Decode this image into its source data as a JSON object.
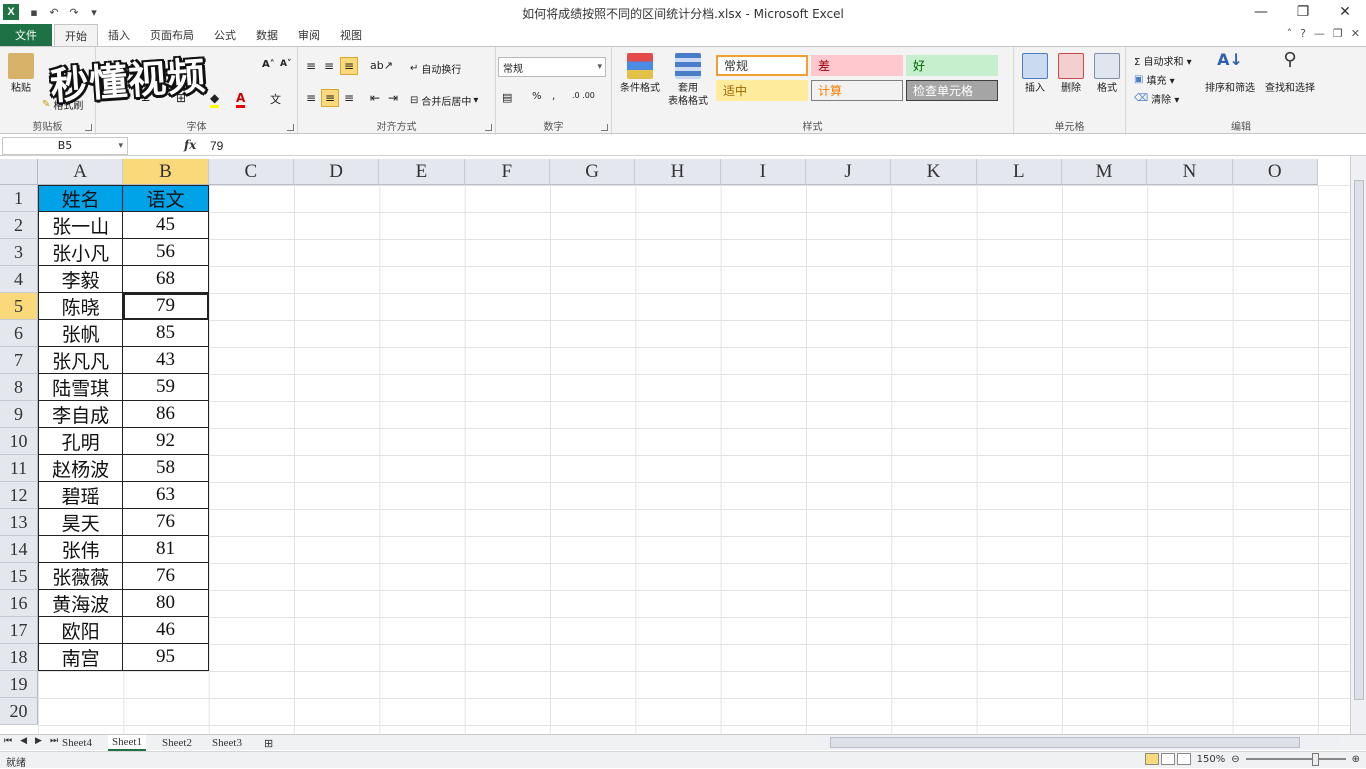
{
  "window": {
    "title": "如何将成绩按照不同的区间统计分档.xlsx - Microsoft Excel",
    "logo": "X"
  },
  "ribbon_tabs": [
    "文件",
    "开始",
    "插入",
    "页面布局",
    "公式",
    "数据",
    "审阅",
    "视图"
  ],
  "active_tab": "开始",
  "ribbon": {
    "clipboard": {
      "paste": "粘贴",
      "format_painter": "格式刷",
      "label": "剪贴板"
    },
    "font": {
      "label": "字体",
      "bold": "B",
      "italic": "I",
      "underline": "U",
      "grow": "A˄",
      "shrink": "A˅"
    },
    "alignment": {
      "wrap": "自动换行",
      "merge": "合并后居中",
      "label": "对齐方式"
    },
    "number": {
      "format": "常规",
      "label": "数字",
      "percent": "%",
      "comma": ",",
      "inc_dec": ".0 .00"
    },
    "styles": {
      "cond_format": "条件格式",
      "table_format_1": "套用",
      "table_format_2": "表格格式",
      "cells": [
        {
          "text": "常规",
          "bg": "#ffffff",
          "color": "#333333",
          "border": "#f0a030"
        },
        {
          "text": "差",
          "bg": "#ffc7ce",
          "color": "#9c0006",
          "border": "#ffc7ce"
        },
        {
          "text": "好",
          "bg": "#c6efce",
          "color": "#006100",
          "border": "#c6efce"
        },
        {
          "text": "适中",
          "bg": "#ffeb9c",
          "color": "#9c6500",
          "border": "#ffeb9c"
        },
        {
          "text": "计算",
          "bg": "#f2f2f2",
          "color": "#fa7d00",
          "border": "#7f7f7f"
        },
        {
          "text": "检查单元格",
          "bg": "#a5a5a5",
          "color": "#ffffff",
          "border": "#3f3f3f"
        }
      ],
      "label": "样式"
    },
    "cells": {
      "insert": "插入",
      "delete": "删除",
      "format": "格式",
      "label": "单元格"
    },
    "editing": {
      "autosum": "Σ 自动求和 ▾",
      "fill": "填充 ▾",
      "clear": "清除 ▾",
      "sort": "排序和筛选",
      "find": "查找和选择",
      "label": "编辑"
    }
  },
  "watermark": "秒懂视频",
  "formula_bar": {
    "name_box": "B5",
    "fx": "fx",
    "value": "79"
  },
  "columns": [
    "A",
    "B",
    "C",
    "D",
    "E",
    "F",
    "G",
    "H",
    "I",
    "J",
    "K",
    "L",
    "M",
    "N",
    "O"
  ],
  "selected_column": "B",
  "selected_row": 5,
  "rows": [
    "1",
    "2",
    "3",
    "4",
    "5",
    "6",
    "7",
    "8",
    "9",
    "10",
    "11",
    "12",
    "13",
    "14",
    "15",
    "16",
    "17",
    "18",
    "19",
    "20"
  ],
  "table": {
    "headers": [
      "姓名",
      "语文"
    ],
    "data": [
      [
        "张一山",
        "45"
      ],
      [
        "张小凡",
        "56"
      ],
      [
        "李毅",
        "68"
      ],
      [
        "陈晓",
        "79"
      ],
      [
        "张帆",
        "85"
      ],
      [
        "张凡凡",
        "43"
      ],
      [
        "陆雪琪",
        "59"
      ],
      [
        "李自成",
        "86"
      ],
      [
        "孔明",
        "92"
      ],
      [
        "赵杨波",
        "58"
      ],
      [
        "碧瑶",
        "63"
      ],
      [
        "昊天",
        "76"
      ],
      [
        "张伟",
        "81"
      ],
      [
        "张薇薇",
        "76"
      ],
      [
        "黄海波",
        "80"
      ],
      [
        "欧阳",
        "46"
      ],
      [
        "南宫",
        "95"
      ]
    ]
  },
  "sheets": [
    "Sheet4",
    "Sheet1",
    "Sheet2",
    "Sheet3"
  ],
  "active_sheet": "Sheet1",
  "status": {
    "ready": "就绪",
    "zoom": "150%"
  },
  "colors": {
    "header_fill": "#00a2e8",
    "selection_header": "#f9d97a",
    "file_tab": "#1e7145"
  }
}
